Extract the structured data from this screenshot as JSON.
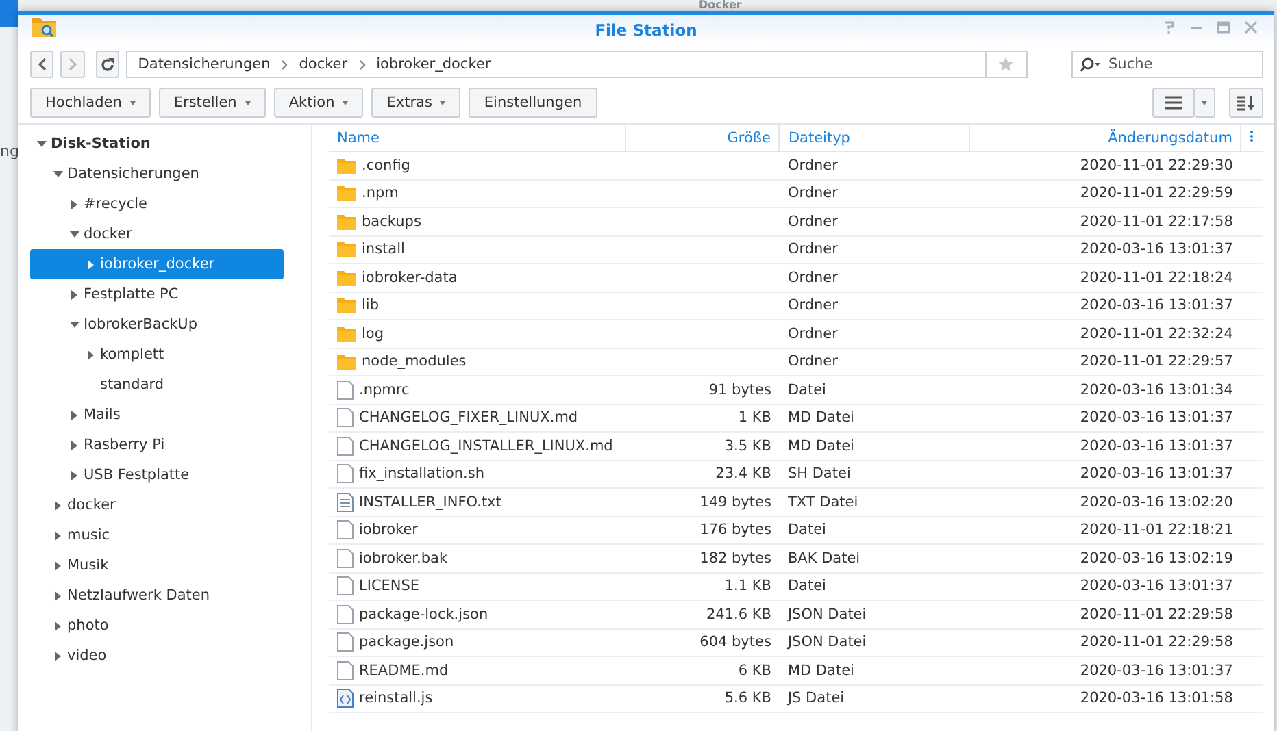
{
  "background": {
    "title": "Docker",
    "side_text": "ng"
  },
  "window": {
    "title": "File Station"
  },
  "nav": {
    "path": [
      "Datensicherungen",
      "docker",
      "iobroker_docker"
    ],
    "search": {
      "placeholder": "Suche"
    }
  },
  "toolbar": {
    "buttons": [
      {
        "label": "Hochladen",
        "dropdown": true
      },
      {
        "label": "Erstellen",
        "dropdown": true
      },
      {
        "label": "Aktion",
        "dropdown": true
      },
      {
        "label": "Extras",
        "dropdown": true
      },
      {
        "label": "Einstellungen",
        "dropdown": false
      }
    ]
  },
  "sidebar": {
    "tree": [
      {
        "label": "Disk-Station",
        "expanded": true,
        "selected": false,
        "children": [
          {
            "label": "Datensicherungen",
            "expanded": true,
            "selected": false,
            "children": [
              {
                "label": "#recycle",
                "expanded": false,
                "selected": false
              },
              {
                "label": "docker",
                "expanded": true,
                "selected": false,
                "children": [
                  {
                    "label": "iobroker_docker",
                    "expanded": false,
                    "selected": true
                  }
                ]
              },
              {
                "label": "Festplatte PC",
                "expanded": false,
                "selected": false
              },
              {
                "label": "IobrokerBackUp",
                "expanded": true,
                "selected": false,
                "children": [
                  {
                    "label": "komplett",
                    "expanded": false,
                    "selected": false
                  },
                  {
                    "label": "standard",
                    "leaf": true,
                    "expanded": false,
                    "selected": false
                  }
                ]
              },
              {
                "label": "Mails",
                "expanded": false,
                "selected": false
              },
              {
                "label": "Rasberry Pi",
                "expanded": false,
                "selected": false
              },
              {
                "label": "USB Festplatte",
                "expanded": false,
                "selected": false
              }
            ]
          },
          {
            "label": "docker",
            "expanded": false,
            "selected": false
          },
          {
            "label": "music",
            "expanded": false,
            "selected": false
          },
          {
            "label": "Musik",
            "expanded": false,
            "selected": false
          },
          {
            "label": "Netzlaufwerk Daten",
            "expanded": false,
            "selected": false
          },
          {
            "label": "photo",
            "expanded": false,
            "selected": false
          },
          {
            "label": "video",
            "expanded": false,
            "selected": false
          }
        ]
      }
    ]
  },
  "table": {
    "columns": [
      "Name",
      "Größe",
      "Dateityp",
      "Änderungsdatum"
    ],
    "rows": [
      {
        "kind": "folder",
        "name": ".config",
        "size": "",
        "type": "Ordner",
        "modified": "2020-11-01 22:29:30"
      },
      {
        "kind": "folder",
        "name": ".npm",
        "size": "",
        "type": "Ordner",
        "modified": "2020-11-01 22:29:59"
      },
      {
        "kind": "folder",
        "name": "backups",
        "size": "",
        "type": "Ordner",
        "modified": "2020-11-01 22:17:58"
      },
      {
        "kind": "folder",
        "name": "install",
        "size": "",
        "type": "Ordner",
        "modified": "2020-03-16 13:01:37"
      },
      {
        "kind": "folder",
        "name": "iobroker-data",
        "size": "",
        "type": "Ordner",
        "modified": "2020-11-01 22:18:24"
      },
      {
        "kind": "folder",
        "name": "lib",
        "size": "",
        "type": "Ordner",
        "modified": "2020-03-16 13:01:37"
      },
      {
        "kind": "folder",
        "name": "log",
        "size": "",
        "type": "Ordner",
        "modified": "2020-11-01 22:32:24"
      },
      {
        "kind": "folder",
        "name": "node_modules",
        "size": "",
        "type": "Ordner",
        "modified": "2020-11-01 22:29:57"
      },
      {
        "kind": "file",
        "name": ".npmrc",
        "size": "91 bytes",
        "type": "Datei",
        "modified": "2020-03-16 13:01:34"
      },
      {
        "kind": "file",
        "name": "CHANGELOG_FIXER_LINUX.md",
        "size": "1 KB",
        "type": "MD Datei",
        "modified": "2020-03-16 13:01:37"
      },
      {
        "kind": "file",
        "name": "CHANGELOG_INSTALLER_LINUX.md",
        "size": "3.5 KB",
        "type": "MD Datei",
        "modified": "2020-03-16 13:01:37"
      },
      {
        "kind": "file",
        "name": "fix_installation.sh",
        "size": "23.4 KB",
        "type": "SH Datei",
        "modified": "2020-03-16 13:01:37"
      },
      {
        "kind": "text",
        "name": "INSTALLER_INFO.txt",
        "size": "149 bytes",
        "type": "TXT Datei",
        "modified": "2020-03-16 13:02:20"
      },
      {
        "kind": "file",
        "name": "iobroker",
        "size": "176 bytes",
        "type": "Datei",
        "modified": "2020-11-01 22:18:21"
      },
      {
        "kind": "file",
        "name": "iobroker.bak",
        "size": "182 bytes",
        "type": "BAK Datei",
        "modified": "2020-03-16 13:02:19"
      },
      {
        "kind": "file",
        "name": "LICENSE",
        "size": "1.1 KB",
        "type": "Datei",
        "modified": "2020-03-16 13:01:37"
      },
      {
        "kind": "file",
        "name": "package-lock.json",
        "size": "241.6 KB",
        "type": "JSON Datei",
        "modified": "2020-11-01 22:29:58"
      },
      {
        "kind": "file",
        "name": "package.json",
        "size": "604 bytes",
        "type": "JSON Datei",
        "modified": "2020-11-01 22:29:58"
      },
      {
        "kind": "file",
        "name": "README.md",
        "size": "6 KB",
        "type": "MD Datei",
        "modified": "2020-03-16 13:01:37"
      },
      {
        "kind": "code",
        "name": "reinstall.js",
        "size": "5.6 KB",
        "type": "JS Datei",
        "modified": "2020-03-16 13:01:58"
      }
    ]
  }
}
